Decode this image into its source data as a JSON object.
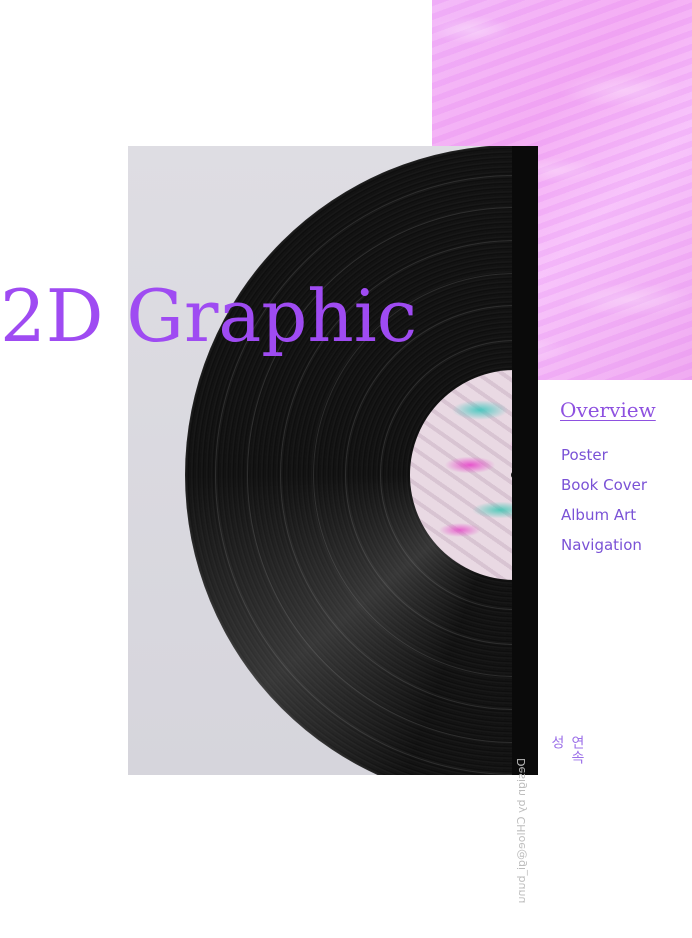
{
  "hero": {
    "headline": "2D Graphic"
  },
  "album": {
    "spine_credit": "Design by CHloe@gi_bunu"
  },
  "overview": {
    "title": "Overview",
    "items": [
      {
        "label": "Poster"
      },
      {
        "label": "Book Cover"
      },
      {
        "label": "Album Art"
      },
      {
        "label": "Navigation"
      }
    ]
  },
  "caption": {
    "vertical_text": "연속성"
  },
  "colors": {
    "accent_purple": "#9f4bf2",
    "nav_purple": "#7a52d6",
    "pink_texture": "#f3aaf2",
    "frame_grey": "#dedde3",
    "spine_black": "#0a0a0a"
  }
}
